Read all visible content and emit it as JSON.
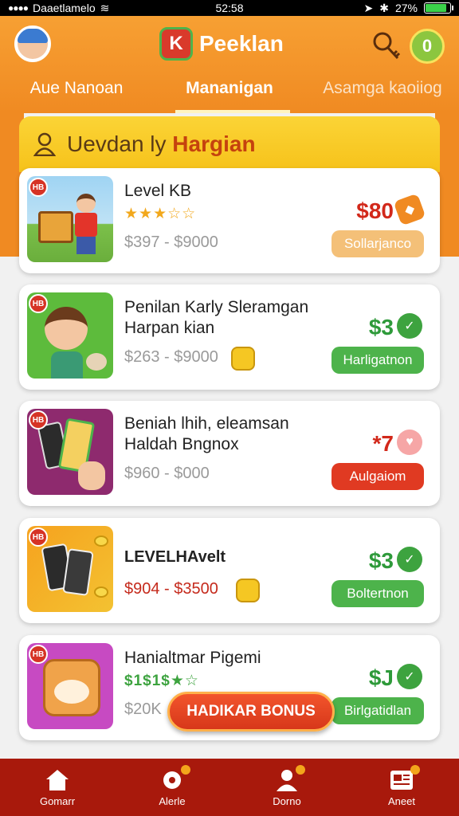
{
  "status_bar": {
    "carrier": "Daaetlamelo",
    "time": "52:58",
    "battery": "27%",
    "battery_level": 0.85
  },
  "header": {
    "logo_text": "K",
    "brand_title": "Peeklan",
    "coin_badge": "0"
  },
  "tabs": [
    "Aue Nanoan",
    "Mananigan",
    "Asamga kaoiiog"
  ],
  "section": {
    "title_lead": "Uevdan ly",
    "title_highlight": "Hargian"
  },
  "cards": [
    {
      "title": "Level KB",
      "stars": "★★★☆☆",
      "price_range": "$397 - $9000",
      "price": "$80",
      "price_color": "#d2281a",
      "button": "Sollarjanco",
      "button_color": "#f4c078",
      "icon": "tag-icon",
      "image": "kid-with-board-image"
    },
    {
      "title": "Penilan Karly Sleramgan Harpan kian",
      "stars": "",
      "price_range": "$263 - $9000",
      "price": "$3",
      "price_color": "#2e9a3a",
      "button": "Harligatnon",
      "button_color": "#4db34b",
      "icon": "check-icon",
      "image": "boy-with-dog-image"
    },
    {
      "title": "Beniah lhih, eleamsan Haldah Bngnox",
      "stars": "",
      "price_range": "$960 - $000",
      "price": "*7",
      "price_color": "#d2281a",
      "button": "Aulgaiom",
      "button_color": "#e03a22",
      "icon": "heart-icon",
      "image": "phones-hand-image"
    },
    {
      "title": "LEVELHAvelt",
      "stars": "",
      "price_range": "$904 - $3500",
      "price": "$3",
      "price_color": "#2e9a3a",
      "button": "Boltertnon",
      "button_color": "#4db34b",
      "icon": "check-icon",
      "image": "phones-coins-image"
    },
    {
      "title": "Hanialtmar Pigemi",
      "stars": "$1$1$★☆",
      "price_range": "$20K",
      "price": "$J",
      "price_color": "#2e9a3a",
      "button": "Birlgatidlan",
      "button_color": "#4db34b",
      "icon": "check-icon",
      "image": "bear-cube-image"
    }
  ],
  "bonus_button": "HADIKAR BONUS",
  "bottom_nav": [
    {
      "label": "Gomarr",
      "icon": "home-icon"
    },
    {
      "label": "Alerle",
      "icon": "gear-icon"
    },
    {
      "label": "Dorno",
      "icon": "profile-icon"
    },
    {
      "label": "Aneet",
      "icon": "news-icon"
    }
  ]
}
